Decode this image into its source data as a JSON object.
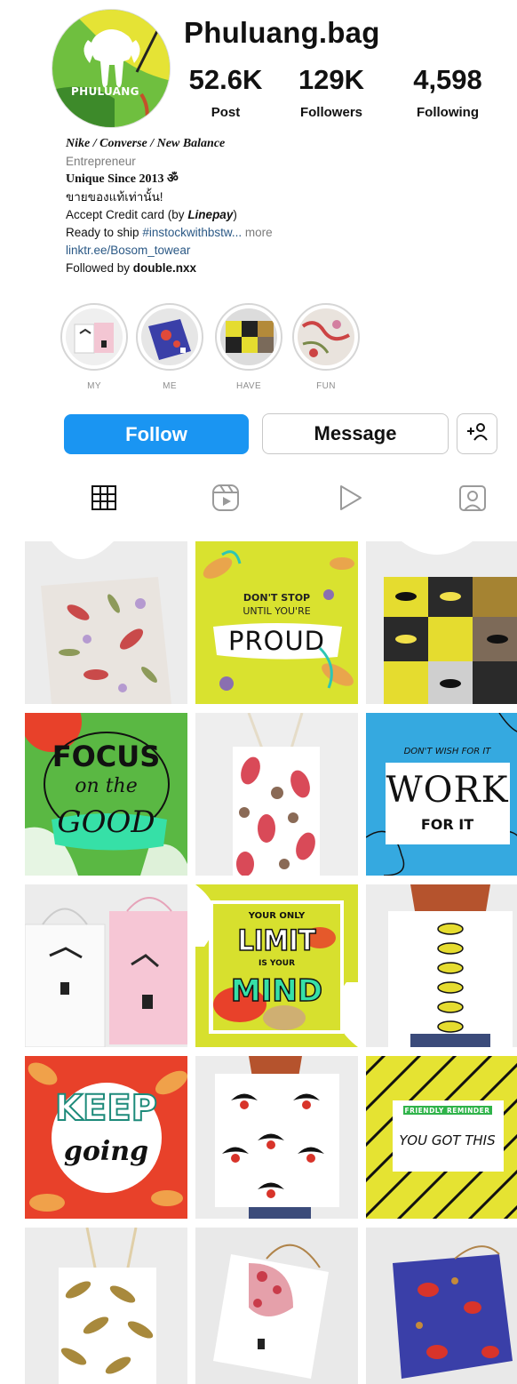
{
  "profile": {
    "username": "Phuluang.bag",
    "avatar_text": "PHULUANG",
    "stats": [
      {
        "value": "52.6K",
        "label": "Post"
      },
      {
        "value": "129K",
        "label": "Followers"
      },
      {
        "value": "4,598",
        "label": "Following"
      }
    ]
  },
  "bio": {
    "brands": "Nike / Converse / New Balance",
    "category": "Entrepreneur",
    "since": "Unique Since 2013 ॐ",
    "thai": "ขายของแท้เท่านั้น!",
    "credit_prefix": "Accept Credit card (by ",
    "credit_bold": "Linepay",
    "credit_suffix": ")",
    "ready_prefix": "Ready to ship ",
    "ready_tag": "#instockwithbstw...",
    "ready_more": " more",
    "link": "linktr.ee/Bosom_towear",
    "followed_prefix": "Followed by ",
    "followed_user": "double.nxx"
  },
  "highlights": [
    {
      "label": "MY"
    },
    {
      "label": "ME"
    },
    {
      "label": "HAVE"
    },
    {
      "label": "FUN"
    }
  ],
  "actions": {
    "follow": "Follow",
    "message": "Message"
  },
  "tabs": [
    {
      "icon": "grid-icon"
    },
    {
      "icon": "reels-icon"
    },
    {
      "icon": "play-icon"
    },
    {
      "icon": "tagged-icon"
    }
  ],
  "posts": {
    "p2_line1": "DON'T STOP",
    "p2_line2": "UNTIL YOU'RE",
    "p2_line3": "PROUD",
    "p4_line1": "FOCUS",
    "p4_line2": "on the",
    "p4_line3": "GOOD",
    "p6_line1": "DON'T WISH FOR IT",
    "p6_line2": "WORK",
    "p6_line3": "FOR IT",
    "p8_line1": "YOUR ONLY",
    "p8_line2": "LIMIT",
    "p8_line3": "IS YOUR",
    "p8_line4": "MIND",
    "p10_line1": "KEEP",
    "p10_line2": "going",
    "p12_line1": "FRIENDLY REMINDER",
    "p12_line2": "YOU GOT THIS"
  },
  "colors": {
    "accent": "#1a95f2",
    "link": "#2a5885",
    "lime": "#d7e02e",
    "sky": "#35a9e0",
    "red": "#e8412a"
  }
}
